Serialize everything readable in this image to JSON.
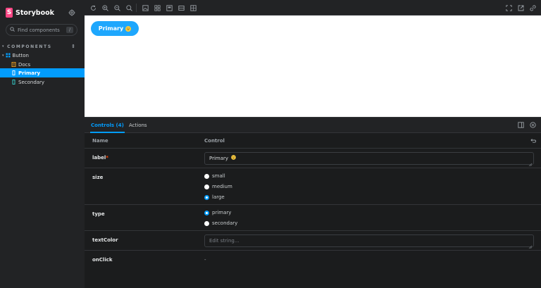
{
  "sidebar": {
    "brand": "Storybook",
    "brand_logo": "S",
    "search_placeholder": "Find components",
    "search_shortcut": "/",
    "section_label": "COMPONENTS",
    "items": [
      {
        "label": "Button",
        "icon": "component-icon"
      },
      {
        "label": "Docs",
        "icon": "document-icon"
      },
      {
        "label": "Primary",
        "icon": "bookmark-icon"
      },
      {
        "label": "Secondary",
        "icon": "bookmark-icon"
      }
    ]
  },
  "toolbar": {
    "icons": [
      "sync-icon",
      "zoom-in-icon",
      "zoom-out-icon",
      "zoom-reset-icon",
      "photo-icon",
      "grid-icon",
      "outline-icon",
      "measure-icon",
      "ruler-icon",
      "fullscreen-icon",
      "share-icon",
      "link-icon"
    ]
  },
  "preview": {
    "button_label": "Primary"
  },
  "panel": {
    "tabs": [
      {
        "label": "Controls (4)"
      },
      {
        "label": "Actions"
      }
    ],
    "header": {
      "name": "Name",
      "control": "Control"
    },
    "rows": {
      "label": {
        "name": "label",
        "required": "*",
        "value": "Primary"
      },
      "size": {
        "name": "size",
        "options": [
          "small",
          "medium",
          "large"
        ],
        "selected": "large"
      },
      "type": {
        "name": "type",
        "options": [
          "primary",
          "secondary"
        ],
        "selected": "primary"
      },
      "textColor": {
        "name": "textColor",
        "placeholder": "Edit string..."
      },
      "onClick": {
        "name": "onClick",
        "value": "-"
      }
    }
  },
  "colors": {
    "accent": "#029cfd",
    "brand": "#ff4785",
    "primary_button": "#1ea7fd"
  }
}
